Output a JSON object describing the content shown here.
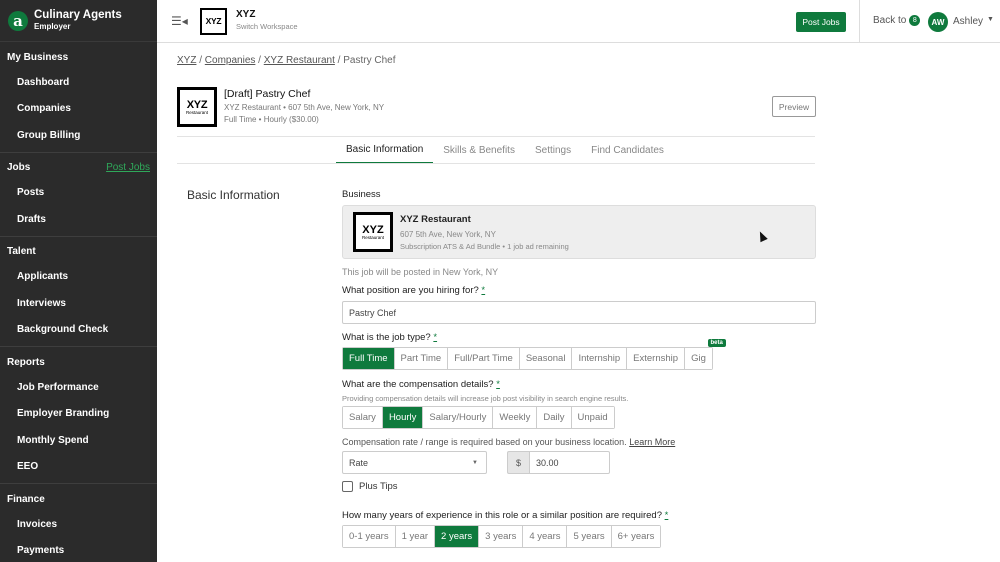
{
  "brand": {
    "name": "Culinary Agents",
    "sub": "Employer"
  },
  "sidebar": {
    "sections": [
      {
        "title": "My Business",
        "link": "",
        "items": [
          "Dashboard",
          "Companies",
          "Group Billing"
        ]
      },
      {
        "title": "Jobs",
        "link": "Post Jobs",
        "items": [
          "Posts",
          "Drafts"
        ]
      },
      {
        "title": "Talent",
        "link": "",
        "items": [
          "Applicants",
          "Interviews",
          "Background Check"
        ]
      },
      {
        "title": "Reports",
        "link": "",
        "items": [
          "Job Performance",
          "Employer Branding",
          "Monthly Spend",
          "EEO"
        ]
      },
      {
        "title": "Finance",
        "link": "",
        "items": [
          "Invoices",
          "Payments"
        ]
      }
    ]
  },
  "topbar": {
    "workspace_logo": "XYZ",
    "workspace_name": "XYZ",
    "switch_label": "Switch Workspace",
    "post_jobs": "Post Jobs",
    "back_to": "Back to",
    "back_count": "8",
    "avatar": "AW",
    "user": "Ashley"
  },
  "breadcrumb": {
    "items": [
      "XYZ",
      "Companies",
      "XYZ Restaurant"
    ],
    "current": "Pastry Chef",
    "sep": " / "
  },
  "job": {
    "logo_big": "XYZ",
    "logo_small": "Restaurant",
    "title": "[Draft] Pastry Chef",
    "location": "XYZ Restaurant • 607 5th Ave, New York, NY",
    "type": "Full Time • Hourly ($30.00)",
    "preview": "Preview"
  },
  "tabs": [
    {
      "label": "Basic Information",
      "active": true
    },
    {
      "label": "Skills & Benefits",
      "active": false
    },
    {
      "label": "Settings",
      "active": false
    },
    {
      "label": "Find Candidates",
      "active": false
    }
  ],
  "form": {
    "section_title": "Basic Information",
    "business_label": "Business",
    "business": {
      "name": "XYZ Restaurant",
      "address": "607 5th Ave, New York, NY",
      "plan": "Subscription ATS & Ad Bundle • 1 job ad remaining"
    },
    "posted_in": "This job will be posted in New York, NY",
    "position_label": "What position are you hiring for?",
    "position_value": "Pastry Chef",
    "job_type_label": "What is the job type?",
    "job_types": [
      "Full Time",
      "Part Time",
      "Full/Part Time",
      "Seasonal",
      "Internship",
      "Externship",
      "Gig"
    ],
    "job_type_selected": 0,
    "beta": "beta",
    "comp_label": "What are the compensation details?",
    "comp_hint": "Providing compensation details will increase job post visibility in search engine results.",
    "comp_types": [
      "Salary",
      "Hourly",
      "Salary/Hourly",
      "Weekly",
      "Daily",
      "Unpaid"
    ],
    "comp_selected": 1,
    "rate_note": "Compensation rate / range is required based on your business location.",
    "learn_more": "Learn More",
    "rate_select": "Rate",
    "currency": "$",
    "amount": "30.00",
    "plus_tips": "Plus Tips",
    "experience_label": "How many years of experience in this role or a similar position are required?",
    "experience": [
      "0-1 years",
      "1 year",
      "2 years",
      "3 years",
      "4 years",
      "5 years",
      "6+ years"
    ],
    "experience_selected": 2,
    "required_marker": "*"
  }
}
